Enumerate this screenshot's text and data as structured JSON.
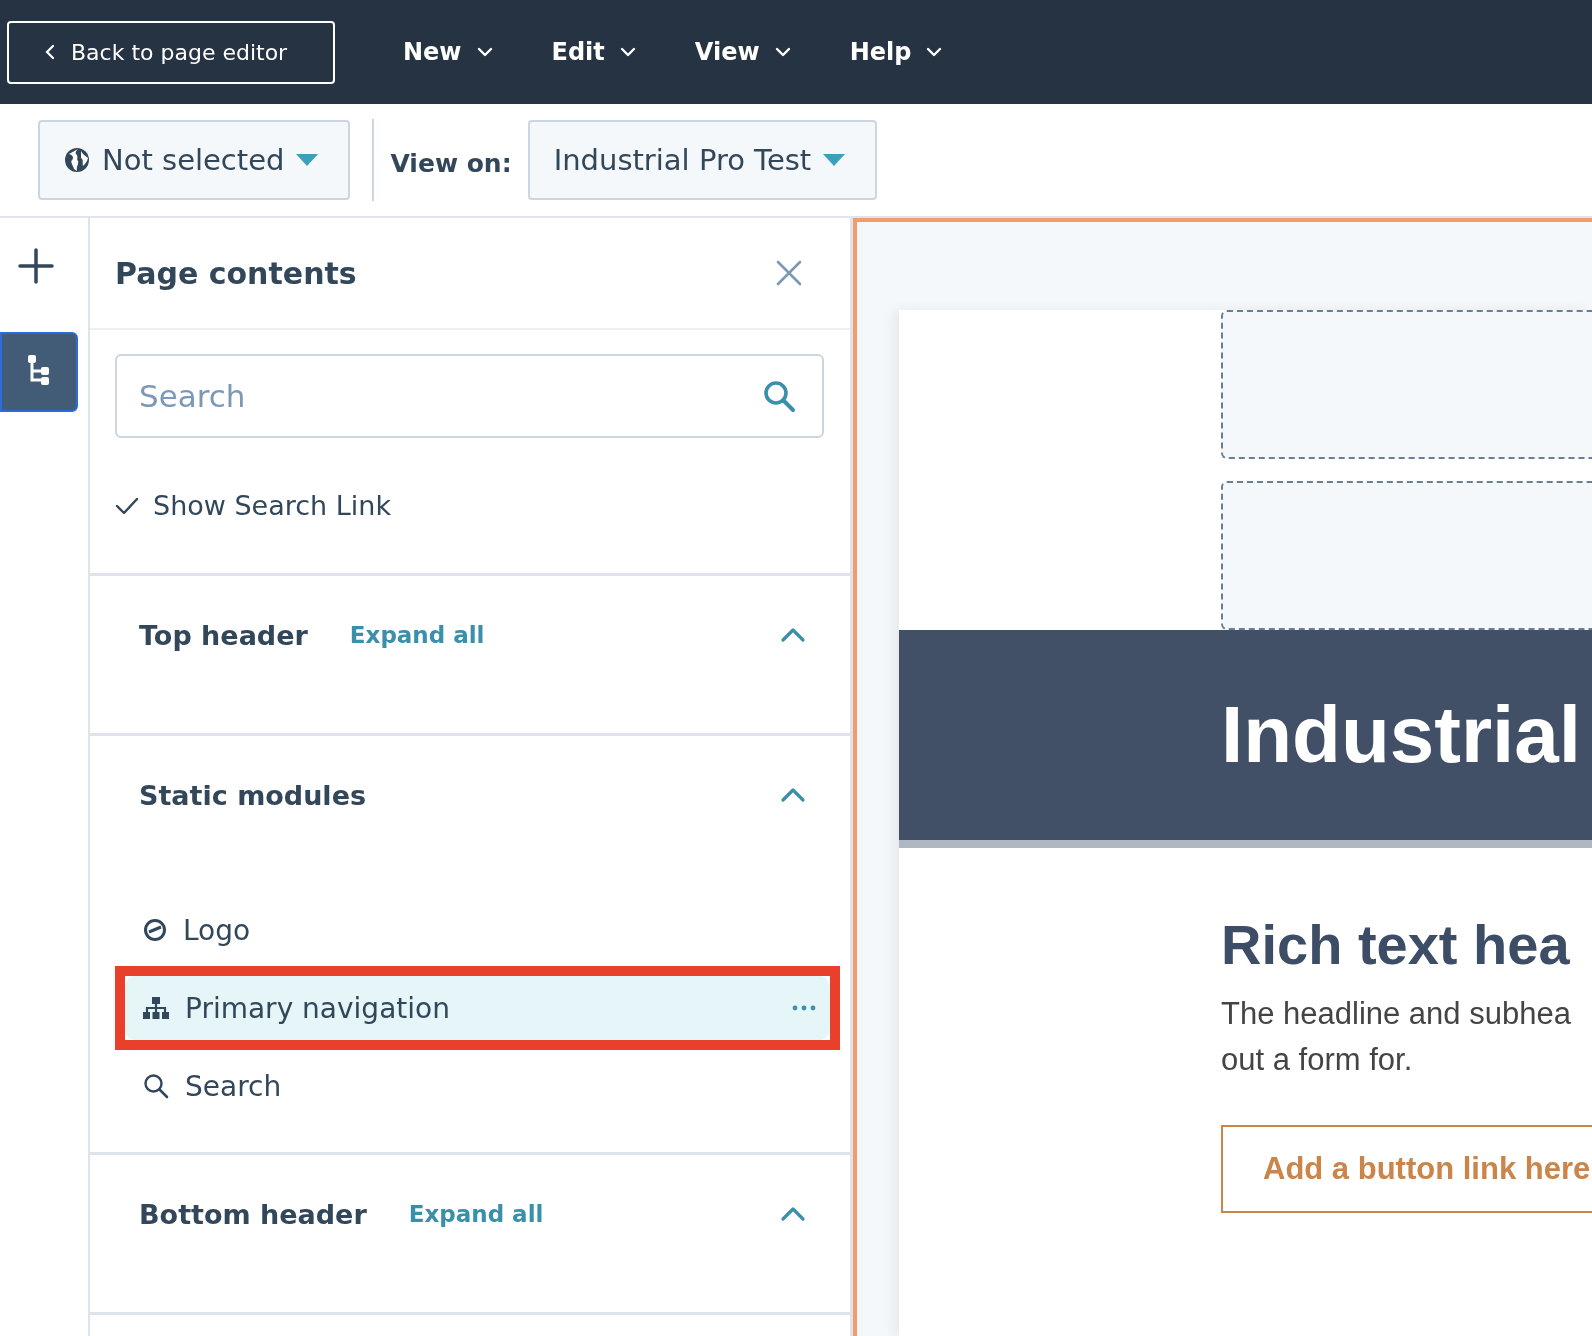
{
  "top_bar": {
    "back_button": "Back to page editor",
    "menus": [
      {
        "label": "New"
      },
      {
        "label": "Edit"
      },
      {
        "label": "View"
      },
      {
        "label": "Help"
      }
    ]
  },
  "toolbar": {
    "language_dropdown": "Not selected",
    "view_on_label": "View on:",
    "view_on_dropdown": "Industrial Pro Test"
  },
  "rail": [
    {
      "kind": "add",
      "selected": false
    },
    {
      "kind": "tree",
      "selected": true
    }
  ],
  "panel": {
    "title": "Page contents",
    "search": {
      "placeholder": "Search"
    },
    "option": {
      "label": "Show Search Link",
      "checked": true
    },
    "sections": [
      {
        "title": "Top header",
        "expand_all": "Expand all",
        "expanded": true
      },
      {
        "title": "Static modules",
        "expanded": true,
        "items": [
          {
            "kind": "logo",
            "label": "Logo",
            "selected": false,
            "highlighted": false
          },
          {
            "kind": "navigation",
            "label": "Primary navigation",
            "selected": true,
            "highlighted": true
          },
          {
            "kind": "search",
            "label": "Search",
            "selected": false,
            "highlighted": false
          }
        ]
      },
      {
        "title": "Bottom header",
        "expand_all": "Expand all",
        "expanded": true
      }
    ]
  },
  "preview": {
    "banner_title": "Industrial",
    "heading": "Rich text hea",
    "paragraph_lines": [
      "The headline and subhea",
      "out a form for."
    ],
    "button": "Add a button link here"
  }
}
